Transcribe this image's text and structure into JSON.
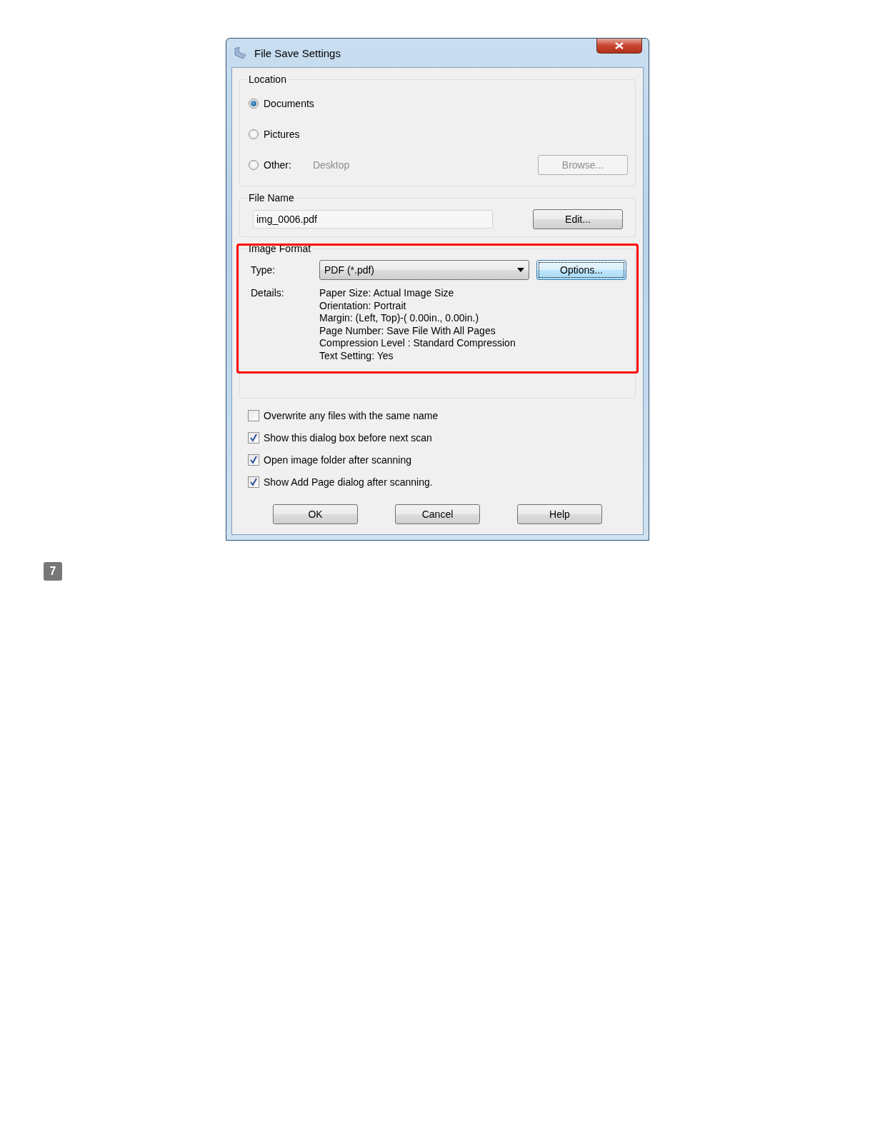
{
  "window": {
    "title": "File Save Settings"
  },
  "location": {
    "legend": "Location",
    "options": [
      {
        "label": "Documents",
        "selected": true
      },
      {
        "label": "Pictures",
        "selected": false
      },
      {
        "label": "Other:",
        "selected": false,
        "path": "Desktop",
        "path_disabled": true
      }
    ],
    "browse_button": {
      "label": "Browse...",
      "disabled": true
    }
  },
  "file_name": {
    "legend": "File Name",
    "value": "img_0006.pdf",
    "edit_button": {
      "label": "Edit...",
      "disabled": false
    }
  },
  "image_format": {
    "legend": "Image Format",
    "highlighted": true,
    "type_label": "Type:",
    "type_value": "PDF (*.pdf)",
    "options_button": {
      "label": "Options...",
      "focused": true
    },
    "details_label": "Details:",
    "details": [
      "Paper Size: Actual Image Size",
      "Orientation: Portrait",
      "Margin: (Left, Top)-( 0.00in., 0.00in.)",
      "Page Number: Save File With All Pages",
      "Compression Level : Standard Compression",
      "Text Setting: Yes"
    ]
  },
  "checkboxes": [
    {
      "label": "Overwrite any files with the same name",
      "checked": false
    },
    {
      "label": "Show this dialog box before next scan",
      "checked": true
    },
    {
      "label": "Open image folder after scanning",
      "checked": true
    },
    {
      "label": "Show Add Page dialog after scanning.",
      "checked": true
    }
  ],
  "buttons": [
    "OK",
    "Cancel",
    "Help"
  ],
  "step": "7"
}
